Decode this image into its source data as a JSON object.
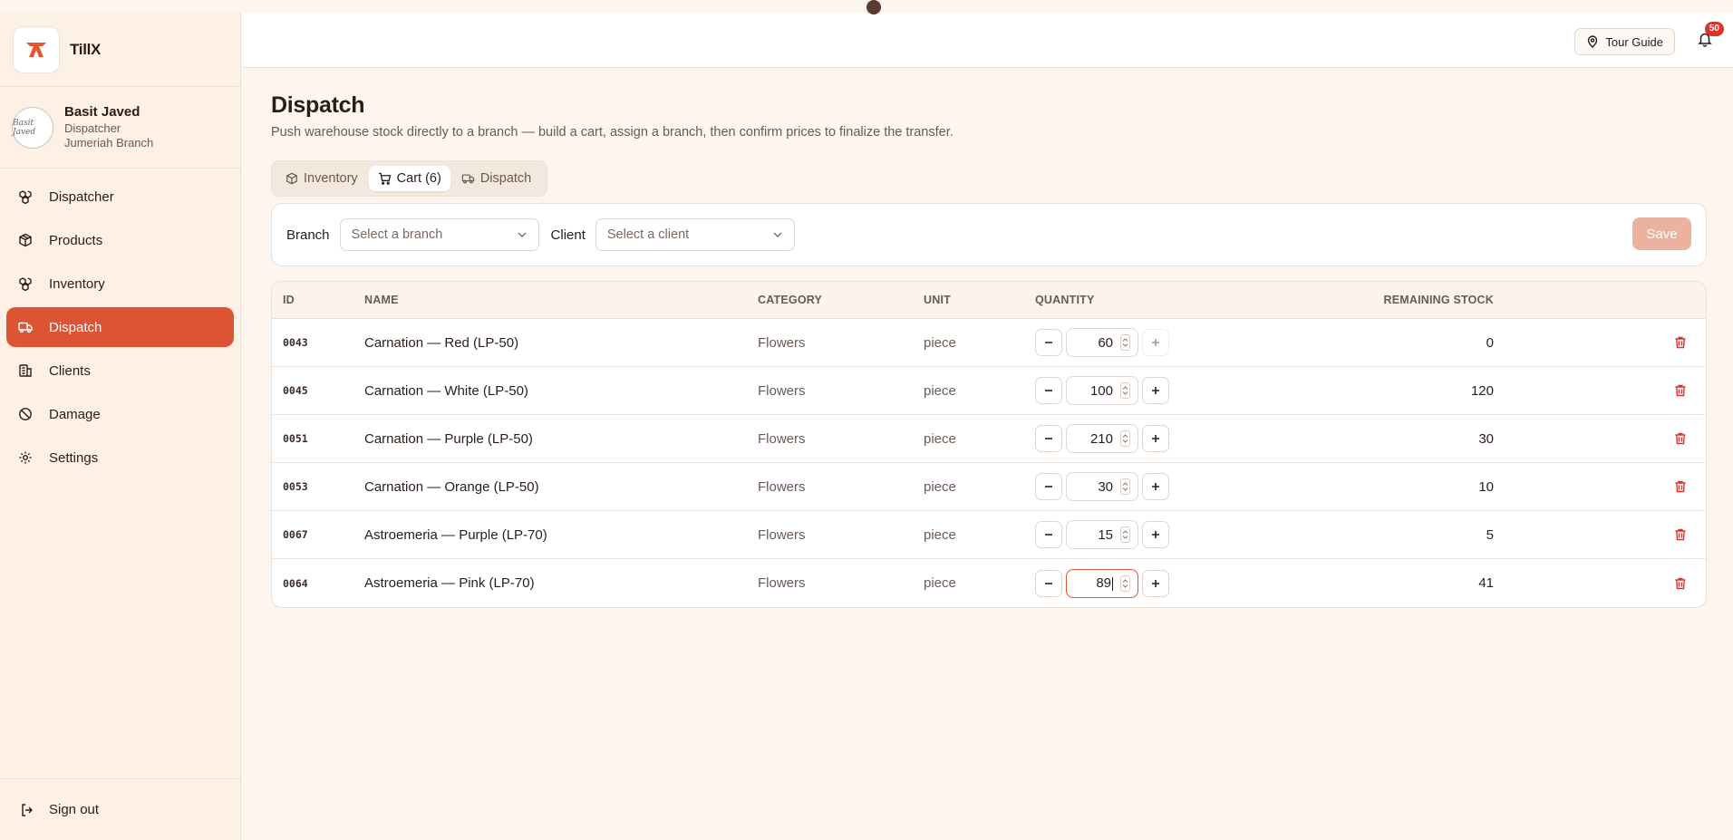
{
  "brand": {
    "name": "TillX"
  },
  "user": {
    "name": "Basit Javed",
    "role": "Dispatcher",
    "branch": "Jumeriah Branch",
    "avatar_text": "Basit Javed"
  },
  "nav": [
    {
      "label": "Dispatcher",
      "icon": "boxes-icon",
      "active": false
    },
    {
      "label": "Products",
      "icon": "package-icon",
      "active": false
    },
    {
      "label": "Inventory",
      "icon": "boxes-icon",
      "active": false
    },
    {
      "label": "Dispatch",
      "icon": "truck-icon",
      "active": true
    },
    {
      "label": "Clients",
      "icon": "building-icon",
      "active": false
    },
    {
      "label": "Damage",
      "icon": "ban-icon",
      "active": false
    },
    {
      "label": "Settings",
      "icon": "gear-icon",
      "active": false
    }
  ],
  "signout": {
    "label": "Sign out"
  },
  "header": {
    "tour_label": "Tour Guide",
    "notification_count": "50"
  },
  "page": {
    "title": "Dispatch",
    "subtitle": "Push warehouse stock directly to a branch — build a cart, assign a branch, then confirm prices to finalize the transfer."
  },
  "tabs": [
    {
      "label": "Inventory",
      "active": false
    },
    {
      "label": "Cart (6)",
      "active": true
    },
    {
      "label": "Dispatch",
      "active": false
    }
  ],
  "filters": {
    "branch_label": "Branch",
    "branch_placeholder": "Select a branch",
    "client_label": "Client",
    "client_placeholder": "Select a client",
    "save_label": "Save"
  },
  "table": {
    "headers": {
      "id": "ID",
      "name": "NAME",
      "category": "CATEGORY",
      "unit": "UNIT",
      "quantity": "QUANTITY",
      "remaining": "REMAINING STOCK"
    },
    "rows": [
      {
        "id": "0043",
        "name": "Carnation — Red (LP-50)",
        "category": "Flowers",
        "unit": "piece",
        "quantity": "60",
        "remaining": "0"
      },
      {
        "id": "0045",
        "name": "Carnation — White (LP-50)",
        "category": "Flowers",
        "unit": "piece",
        "quantity": "100",
        "remaining": "120"
      },
      {
        "id": "0051",
        "name": "Carnation — Purple (LP-50)",
        "category": "Flowers",
        "unit": "piece",
        "quantity": "210",
        "remaining": "30"
      },
      {
        "id": "0053",
        "name": "Carnation — Orange (LP-50)",
        "category": "Flowers",
        "unit": "piece",
        "quantity": "30",
        "remaining": "10"
      },
      {
        "id": "0067",
        "name": "Astroemeria — Purple (LP-70)",
        "category": "Flowers",
        "unit": "piece",
        "quantity": "15",
        "remaining": "5"
      },
      {
        "id": "0064",
        "name": "Astroemeria — Pink (LP-70)",
        "category": "Flowers",
        "unit": "piece",
        "quantity": "89",
        "remaining": "41"
      }
    ]
  },
  "colors": {
    "accent": "#dc5434",
    "background": "#fdf5ee",
    "sidebar": "#fdf0e4",
    "danger": "#e0322a"
  }
}
